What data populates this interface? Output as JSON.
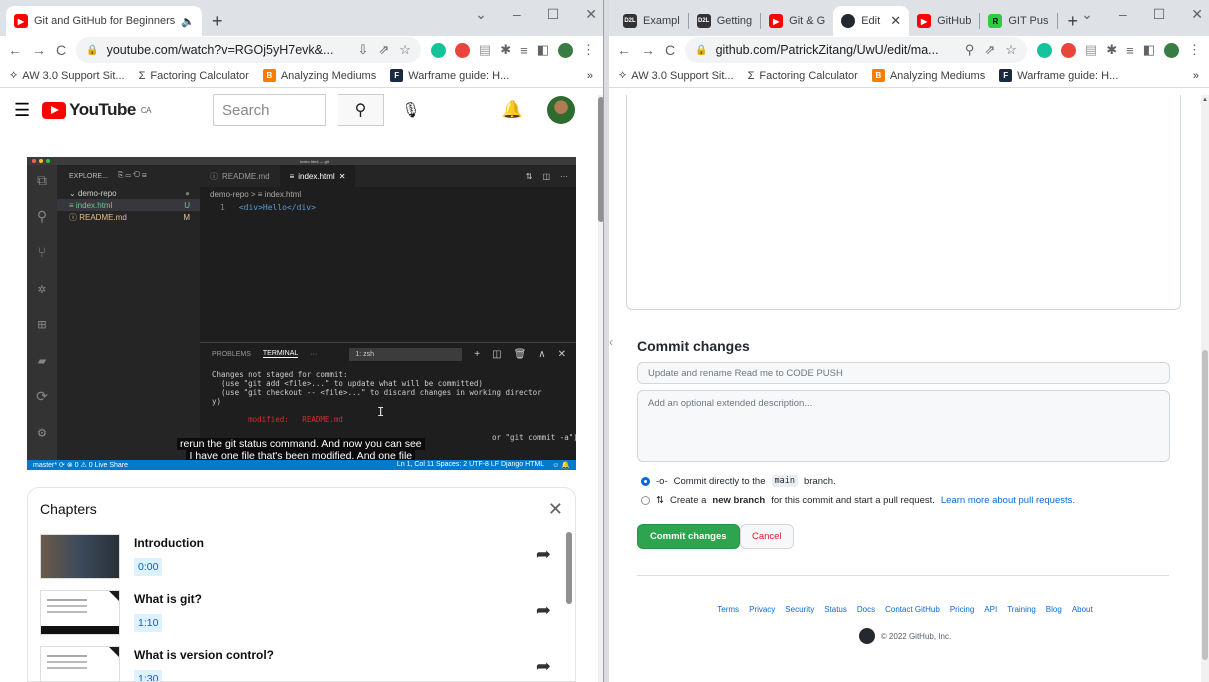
{
  "left": {
    "tabs": [
      {
        "title": "Git and GitHub for Beginners",
        "audio": "🔈"
      }
    ],
    "url": "youtube.com/watch?v=RGOj5yH7evk&...",
    "bookmarks": [
      "AW 3.0 Support Sit...",
      "Factoring Calculator",
      "Analyzing Mediums",
      "Warframe guide: H..."
    ],
    "youtube": {
      "logo": "YouTube",
      "region": "CA",
      "search_placeholder": "Search",
      "video": {
        "window_title": "index.html — git",
        "explorer_title": "EXPLORE...",
        "folder": "demo-repo",
        "files": [
          {
            "name": "index.html",
            "status": "U"
          },
          {
            "name": "README.md",
            "status": "M"
          }
        ],
        "tabs": [
          "README.md",
          "index.html"
        ],
        "breadcrumb": "demo-repo > ≡ index.html",
        "code_line_no": "1",
        "code_line": "<div>Hello</div>",
        "panel_tabs": [
          "PROBLEMS",
          "TERMINAL",
          "···"
        ],
        "terminal_select": "1: zsh",
        "terminal_lines": [
          "Changes not staged for commit:",
          "  (use \"git add <file>...\" to update what will be committed)",
          "  (use \"git checkout -- <file>...\" to discard changes in working director",
          "y)"
        ],
        "terminal_modified": "        modified:   README.md",
        "terminal_tail": "or \"git commit -a\")",
        "caption_1": "rerun the git status command. And now you can see",
        "caption_2": "I have one file that's been modified. And one file",
        "status_left": "master* ⟳  ⊗ 0 ⚠ 0   Live Share",
        "status_right": "Ln 1, Col 11   Spaces: 2   UTF-8   LF   Django HTML"
      },
      "chapters": {
        "title": "Chapters",
        "items": [
          {
            "title": "Introduction",
            "time": "0:00"
          },
          {
            "title": "What is git?",
            "time": "1:10"
          },
          {
            "title": "What is version control?",
            "time": "1:30"
          }
        ]
      }
    }
  },
  "right": {
    "tabs": [
      "Exampl",
      "Getting",
      "Git & G",
      "Edit",
      "GitHub",
      "GIT Pus"
    ],
    "url": "github.com/PatrickZitang/UwU/edit/ma...",
    "bookmarks": [
      "AW 3.0 Support Sit...",
      "Factoring Calculator",
      "Analyzing Mediums",
      "Warframe guide: H..."
    ],
    "commit": {
      "title": "Commit changes",
      "summary_placeholder": "Update and rename Read me to CODE PUSH",
      "desc_placeholder": "Add an optional extended description...",
      "opt1_pre": "Commit directly to the",
      "opt1_branch": "main",
      "opt1_post": "branch.",
      "opt2_pre": "Create a",
      "opt2_bold": "new branch",
      "opt2_mid": "for this commit and start a pull request.",
      "opt2_link": "Learn more about pull requests.",
      "commit_btn": "Commit changes",
      "cancel_btn": "Cancel"
    },
    "footer": {
      "links": [
        "Terms",
        "Privacy",
        "Security",
        "Status",
        "Docs",
        "Contact GitHub",
        "Pricing",
        "API",
        "Training",
        "Blog",
        "About"
      ],
      "copyright": "© 2022 GitHub, Inc."
    }
  }
}
